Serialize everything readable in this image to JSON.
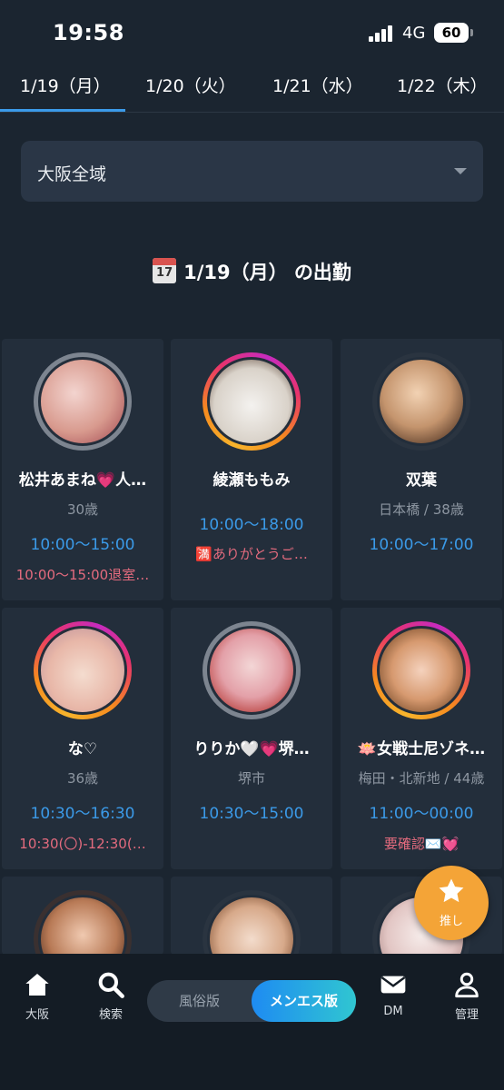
{
  "status_bar": {
    "time": "19:58",
    "network": "4G",
    "battery": "60"
  },
  "date_tabs": [
    "1/19（月）",
    "1/20（火）",
    "1/21（水）",
    "1/22（木）"
  ],
  "region": {
    "selected": "大阪全域"
  },
  "section": {
    "calendar_day": "17",
    "title": "1/19（月） の出勤"
  },
  "cards": [
    {
      "name": "松井あまね💗人…",
      "meta": "30歳",
      "time": "10:00〜15:00",
      "note": "10:00〜15:00退室…"
    },
    {
      "name": "綾瀬ももみ",
      "meta": "",
      "time": "10:00〜18:00",
      "note": "🈵ありがとうご…"
    },
    {
      "name": "双葉",
      "meta": "日本橋 / 38歳",
      "time": "10:00〜17:00",
      "note": ""
    },
    {
      "name": "な♡",
      "meta": "36歳",
      "time": "10:30〜16:30",
      "note": "10:30(〇)-12:30(…"
    },
    {
      "name": "りりか🤍💗堺…",
      "meta": "堺市",
      "time": "10:30〜15:00",
      "note": ""
    },
    {
      "name": "🪷女戦士尼ゾネ…",
      "meta": "梅田・北新地 / 44歳",
      "time": "11:00〜00:00",
      "note": "要確認✉️💓"
    }
  ],
  "fab": {
    "label": "推し"
  },
  "bottom_nav": {
    "home_label": "大阪",
    "search_label": "検索",
    "mode_off_label": "風俗版",
    "mode_on_label": "メンエス版",
    "dm_label": "DM",
    "admin_label": "管理"
  },
  "colors": {
    "accent": "#3b9ae8",
    "note": "#e46b7e",
    "fab": "#f4a437"
  }
}
